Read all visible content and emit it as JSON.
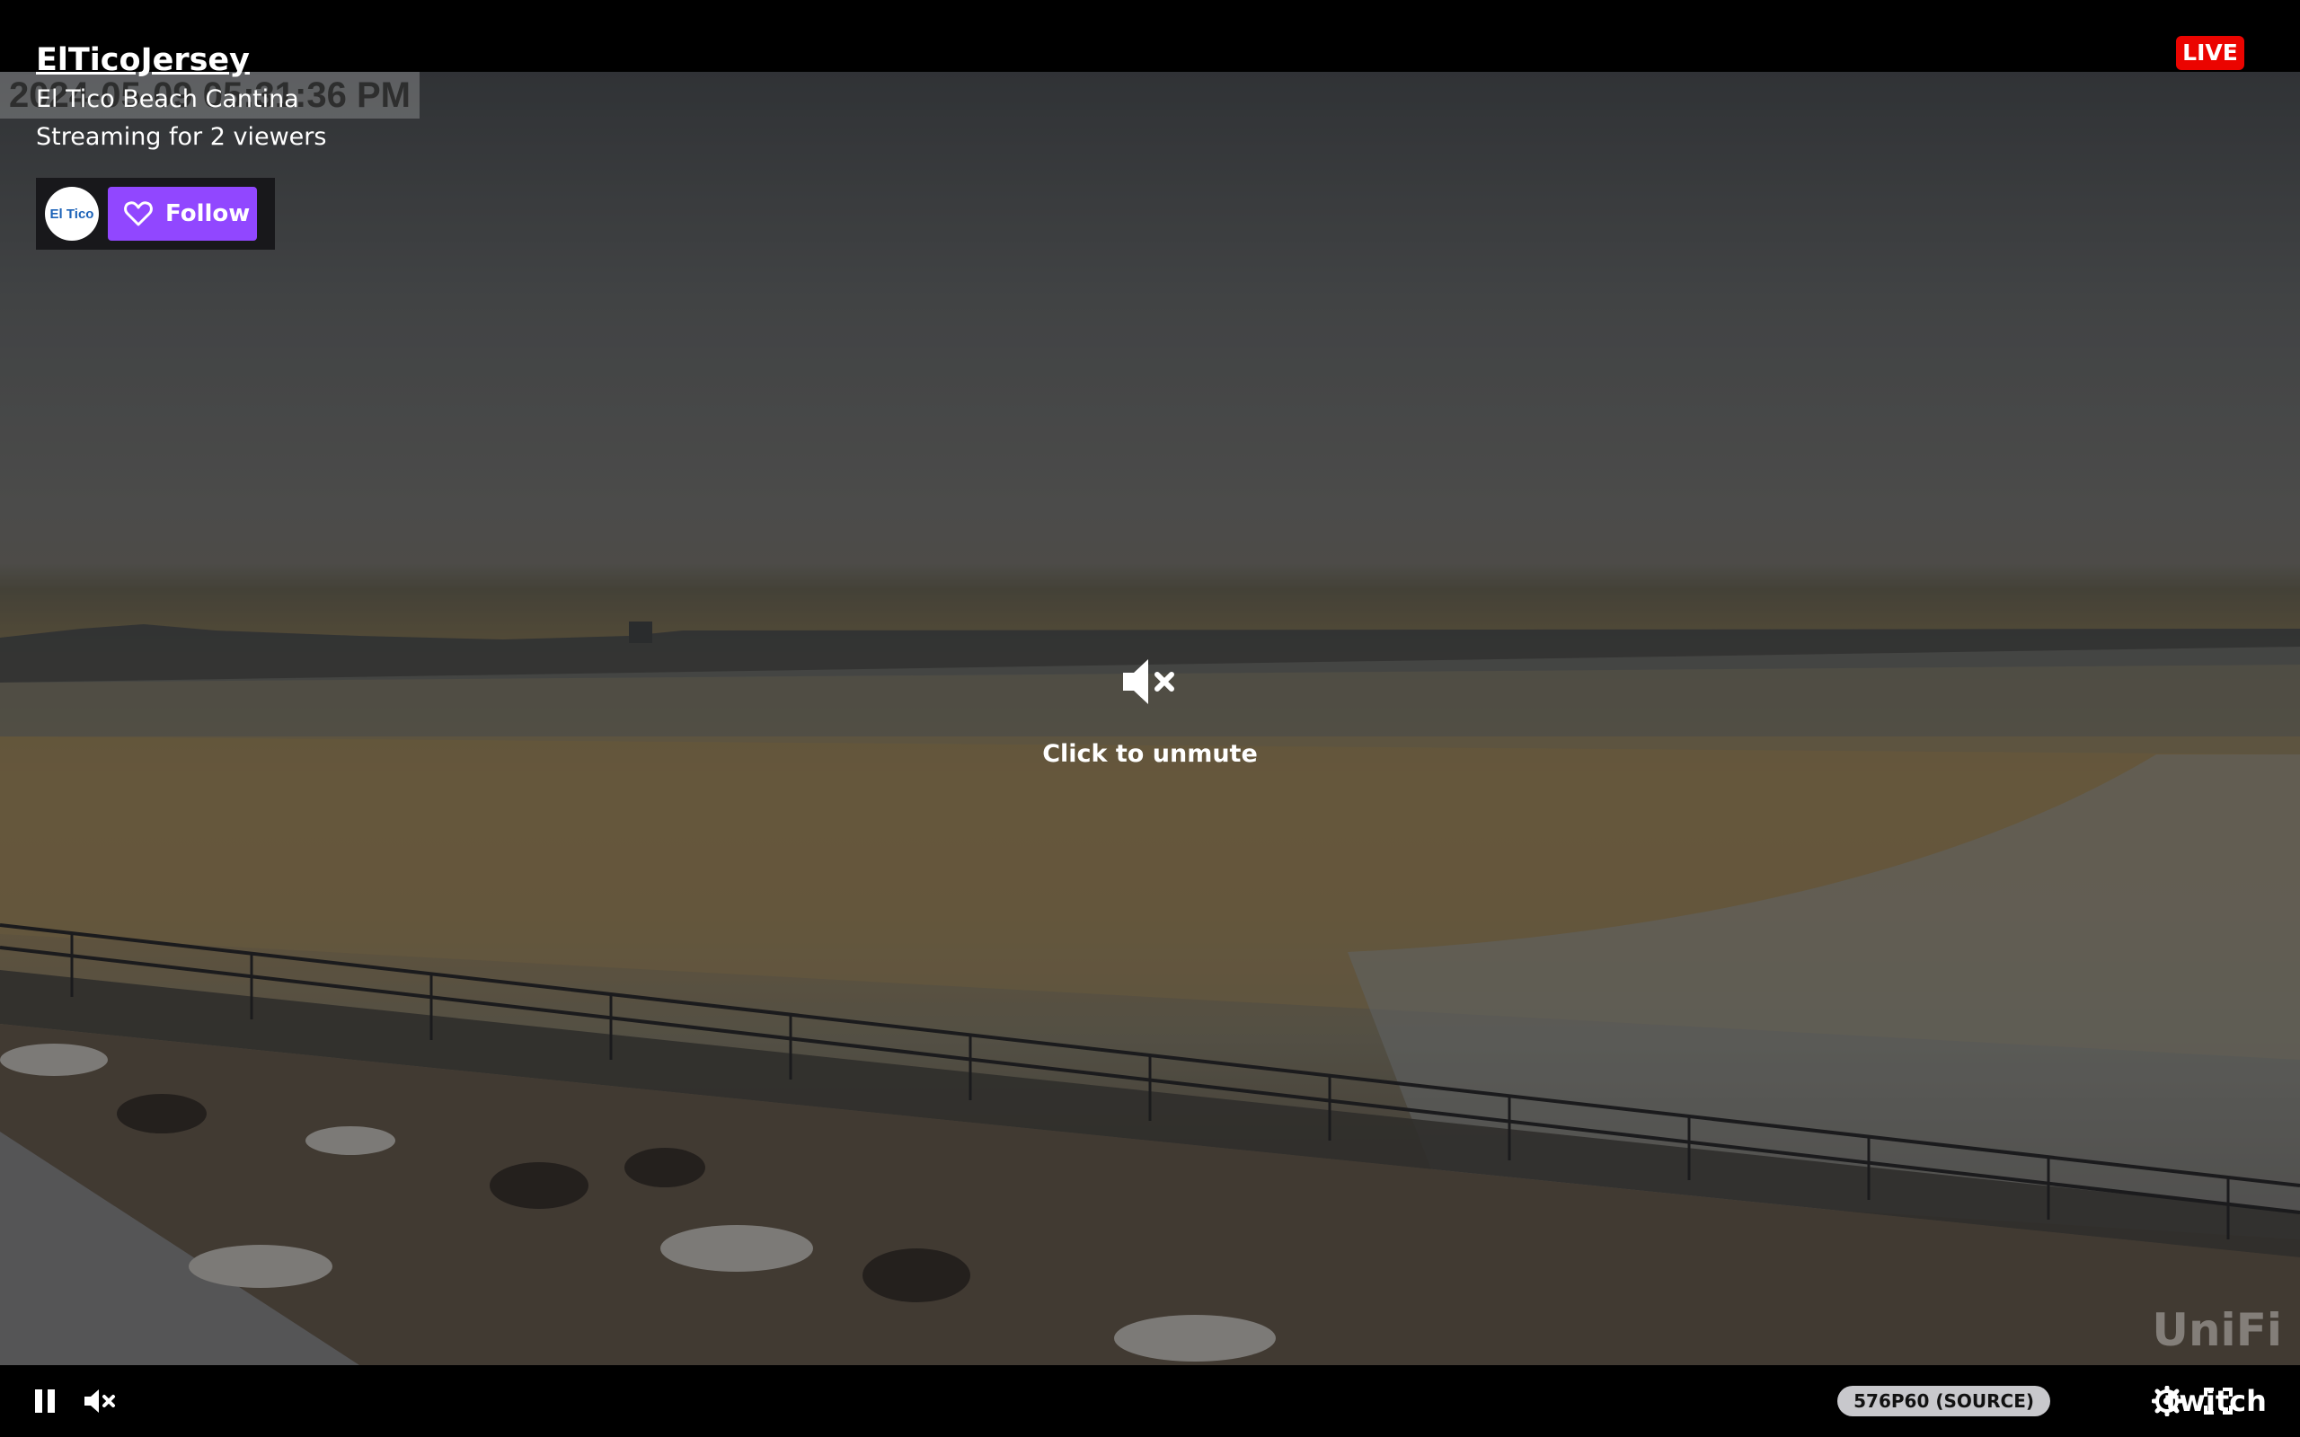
{
  "player": {
    "channel_name": "ElTicoJersey",
    "stream_title": "El Tico Beach Cantina",
    "viewers_text": "Streaming for 2 viewers",
    "follow_label": "Follow",
    "avatar_text": "El Tico",
    "live_label": "LIVE",
    "unmute_label": "Click to unmute",
    "quality_label": "576P60 (SOURCE)",
    "brand_label": "twitch"
  },
  "video": {
    "timestamp_overlay": "2024-05-09 05:31:36 PM",
    "camera_watermark": "UniFi"
  },
  "icons": {
    "pause": "pause-icon",
    "volume": "volume-muted-icon",
    "settings": "gear-icon",
    "fullscreen": "fullscreen-icon",
    "follow": "heart-icon"
  },
  "colors": {
    "follow_button": "#9147ff",
    "live_badge": "#eb0400",
    "bar_background": "#000000"
  }
}
